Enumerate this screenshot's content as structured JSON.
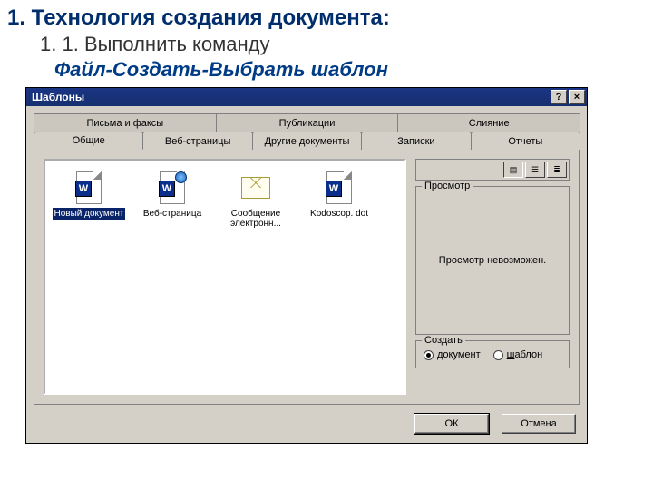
{
  "slide": {
    "heading": "1. Технология создания документа:",
    "sub_number": "1. 1.",
    "sub_text": "Выполнить команду",
    "command": "Файл-Создать-Выбрать шаблон"
  },
  "dialog": {
    "title": "Шаблоны",
    "help_btn": "?",
    "close_btn": "×",
    "tabs_back": [
      "Письма и факсы",
      "Публикации",
      "Слияние"
    ],
    "tabs_front": [
      "Общие",
      "Веб-страницы",
      "Другие документы",
      "Записки",
      "Отчеты"
    ],
    "active_tab": "Общие",
    "items": [
      {
        "label": "Новый документ",
        "kind": "doc",
        "selected": true
      },
      {
        "label": "Веб-страница",
        "kind": "web",
        "selected": false
      },
      {
        "label": "Сообщение электронн...",
        "kind": "mail",
        "selected": false
      },
      {
        "label": "Kodoscop. dot",
        "kind": "doc",
        "selected": false
      }
    ],
    "preview_legend": "Просмотр",
    "preview_text": "Просмотр невозможен.",
    "create_legend": "Создать",
    "create_options": {
      "document": {
        "label": "документ",
        "accel": "д",
        "checked": true
      },
      "template": {
        "label": "шаблон",
        "accel": "ш",
        "checked": false
      }
    },
    "buttons": {
      "ok": "ОК",
      "cancel": "Отмена"
    }
  }
}
